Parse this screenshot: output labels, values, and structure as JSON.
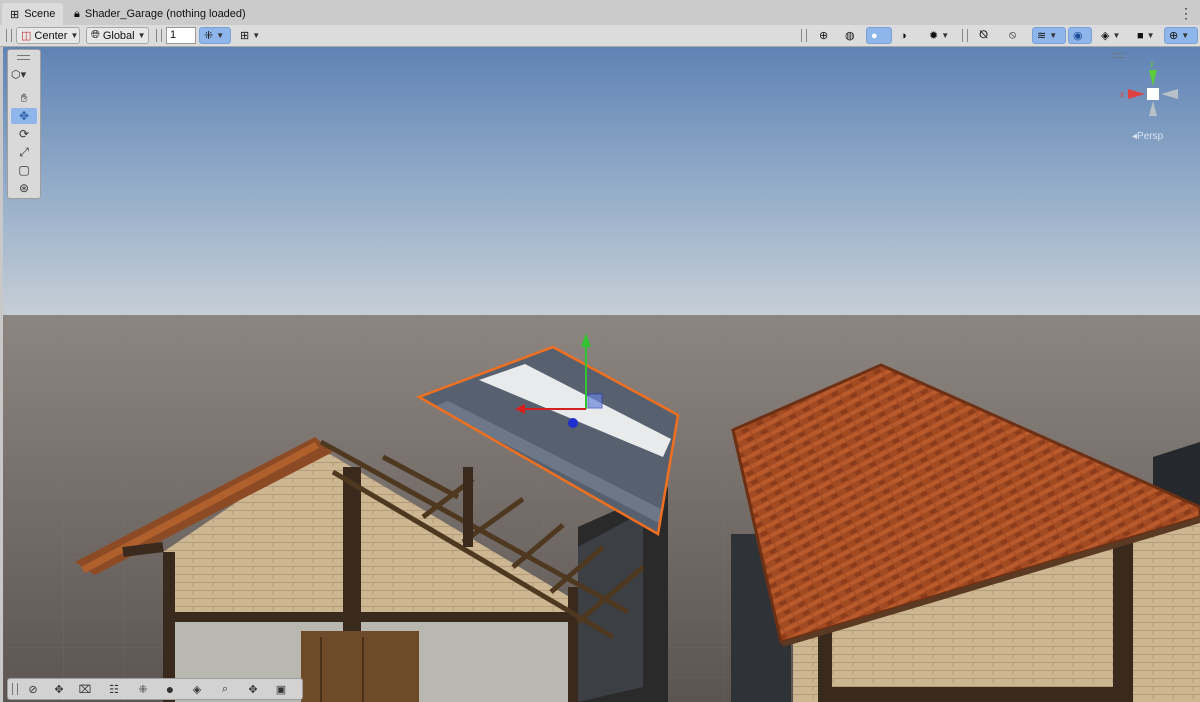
{
  "tabs": [
    {
      "label": "Scene",
      "icon": "grid-icon"
    },
    {
      "label": "Shader_Garage (nothing loaded)",
      "icon": "lock-icon"
    }
  ],
  "toolbar": {
    "pivot_mode": "Center",
    "pivot_space": "Global",
    "grid_value": "1",
    "right_icons": [
      "orientation-icon",
      "shaded-wire-icon",
      "shaded-icon",
      "lighting-icon",
      "effects-icon",
      "audio-mute-icon",
      "fx-icon",
      "layers-icon",
      "visibility-icon",
      "draw-mode-icon",
      "camera-icon",
      "gizmos-icon"
    ]
  },
  "tools": [
    "hand-icon",
    "move-icon",
    "rotate-icon",
    "scale-icon",
    "rect-icon",
    "transform-icon"
  ],
  "active_tool": "move-icon",
  "bottom_tools": [
    "compass-icon",
    "move-icon",
    "crosshair-icon",
    "settings-icon",
    "grid-snap-icon",
    "circle-icon",
    "layers-icon",
    "search-icon",
    "pan-icon",
    "camera-icon"
  ],
  "gizmo": {
    "x_label": "x",
    "y_label": "y",
    "projection": "Persp"
  },
  "colors": {
    "accent": "#8fb6ea",
    "selection_outline": "#f07020",
    "sky_top": "#5f83b5",
    "ground": "#6a625e"
  }
}
